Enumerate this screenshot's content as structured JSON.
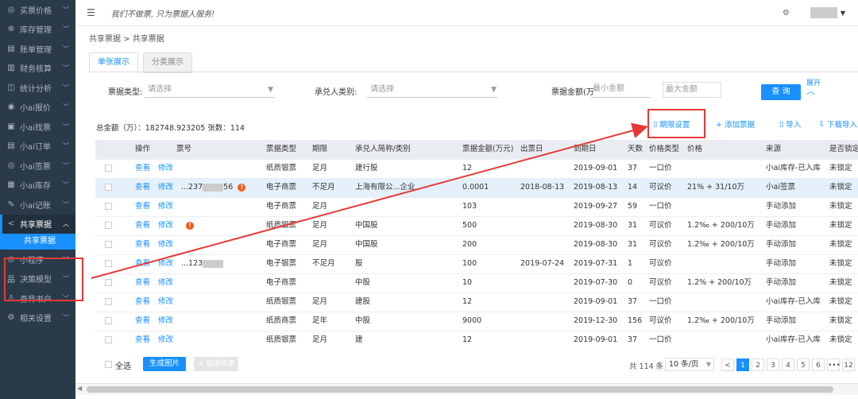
{
  "sidebar": {
    "items": [
      {
        "icon": "tag-icon",
        "glyph": "◎",
        "label": "买票价格"
      },
      {
        "icon": "box-icon",
        "glyph": "⊕",
        "label": "库存管理"
      },
      {
        "icon": "ledger-icon",
        "glyph": "▤",
        "label": "账单管理"
      },
      {
        "icon": "finance-icon",
        "glyph": "▥",
        "label": "财务核算"
      },
      {
        "icon": "chart-icon",
        "glyph": "◫",
        "label": "统计分析"
      },
      {
        "icon": "quote-icon",
        "glyph": "◉",
        "label": "小ai报价"
      },
      {
        "icon": "tickets-icon",
        "glyph": "▣",
        "label": "小ai找票"
      },
      {
        "icon": "order-icon",
        "glyph": "▤",
        "label": "小ai订单"
      },
      {
        "icon": "sign-icon",
        "glyph": "◎",
        "label": "小ai签票"
      },
      {
        "icon": "stock-icon",
        "glyph": "▦",
        "label": "小ai库存"
      },
      {
        "icon": "notes-icon",
        "glyph": "✎",
        "label": "小ai记账"
      },
      {
        "icon": "share-icon",
        "glyph": "<",
        "label": "共享票据"
      },
      {
        "icon": "miniapp-icon",
        "glyph": "◎",
        "label": "小程序"
      },
      {
        "icon": "model-icon",
        "glyph": "品",
        "label": "决策模型"
      },
      {
        "icon": "user-icon",
        "glyph": "♙",
        "label": "查背书户"
      },
      {
        "icon": "settings-icon",
        "glyph": "⚙",
        "label": "相关设置"
      }
    ],
    "sub_item": "共享票据"
  },
  "topbar": {
    "slogan": "我们不做票, 只为票据人服务!"
  },
  "breadcrumb": "共享票据 > 共享票据",
  "tabs": [
    "单张展示",
    "分类展示"
  ],
  "filters": {
    "type_label": "票据类型:",
    "type_placeholder": "请选择",
    "acceptor_label": "承兑人类别:",
    "acceptor_placeholder": "请选择",
    "amount_label": "票据金额(万",
    "min_placeholder": "最小金额",
    "max_placeholder": "最大金额",
    "query": "查 询",
    "expand": "展开"
  },
  "summary": {
    "text": "总金额（万）：182748.923205    张数：114"
  },
  "actions": {
    "term_setting": "期限设置",
    "add": "+ 添加票据",
    "import": "导入",
    "download": "下载导入"
  },
  "table": {
    "headers": [
      "操作",
      "票号",
      "票据类型",
      "期限",
      "承兑人简称/类别",
      "票据金额(万元)",
      "出票日",
      "到期日",
      "天数",
      "价格类型",
      "价格",
      "来源",
      "是否锁定"
    ],
    "view": "查看",
    "edit": "修改",
    "rows": [
      {
        "ticket": "",
        "warn": false,
        "type": "纸质银票",
        "term": "足月",
        "acceptor": "建行股",
        "amount": "12",
        "issue": "",
        "due": "2019-09-01",
        "days": "37",
        "price_type": "一口价",
        "price": "",
        "source": "小ai库存-已入库",
        "lock": "未锁定",
        "sel": false
      },
      {
        "ticket": "...237",
        "ticket_tail": "56",
        "warn": true,
        "type": "电子商票",
        "term": "不足月",
        "acceptor": "上海有限公...企业",
        "amount": "0.0001",
        "issue": "2018-08-13",
        "due": "2019-08-13",
        "days": "14",
        "price_type": "可议价",
        "price": "21% + 31/10万",
        "source": "小ai签票",
        "lock": "未锁定",
        "sel": true
      },
      {
        "ticket": "",
        "warn": false,
        "type": "电子商票",
        "term": "足月",
        "acceptor": "",
        "amount": "103",
        "issue": "",
        "due": "2019-09-27",
        "days": "59",
        "price_type": "一口价",
        "price": "",
        "source": "手动添加",
        "lock": "未锁定",
        "sel": false
      },
      {
        "ticket": "",
        "warn": true,
        "type": "纸质银票",
        "term": "足月",
        "acceptor": "中国股",
        "amount": "500",
        "issue": "",
        "due": "2019-08-30",
        "days": "31",
        "price_type": "可议价",
        "price": "1.2‰ + 200/10万",
        "source": "手动添加",
        "lock": "未锁定",
        "sel": false
      },
      {
        "ticket": "",
        "warn": false,
        "type": "电子商票",
        "term": "足月",
        "acceptor": "中国股",
        "amount": "200",
        "issue": "",
        "due": "2019-08-30",
        "days": "31",
        "price_type": "可议价",
        "price": "1.2‰ + 200/10万",
        "source": "手动添加",
        "lock": "未锁定",
        "sel": false
      },
      {
        "ticket": "...123",
        "warn": false,
        "type": "电子银票",
        "term": "不足月",
        "acceptor": "股",
        "amount": "100",
        "issue": "2019-07-24",
        "due": "2019-07-31",
        "days": "1",
        "price_type": "可议价",
        "price": "",
        "source": "手动添加",
        "lock": "未锁定",
        "sel": false
      },
      {
        "ticket": "",
        "warn": false,
        "type": "电子商票",
        "term": "",
        "acceptor": "中股",
        "amount": "10",
        "issue": "",
        "due": "2019-07-30",
        "days": "0",
        "price_type": "可议价",
        "price": "1.2% + 200/10万",
        "source": "手动添加",
        "lock": "未锁定",
        "sel": false
      },
      {
        "ticket": "",
        "warn": false,
        "type": "纸质银票",
        "term": "足月",
        "acceptor": "建股",
        "amount": "12",
        "issue": "",
        "due": "2019-09-01",
        "days": "37",
        "price_type": "一口价",
        "price": "",
        "source": "小ai库存-已入库",
        "lock": "未锁定",
        "sel": false
      },
      {
        "ticket": "",
        "warn": false,
        "type": "纸质商票",
        "term": "足年",
        "acceptor": "中股",
        "amount": "9000",
        "issue": "",
        "due": "2019-12-30",
        "days": "156",
        "price_type": "可议价",
        "price": "1.2‰ + 200/10万",
        "source": "手动添加",
        "lock": "未锁定",
        "sel": false
      },
      {
        "ticket": "",
        "warn": false,
        "type": "纸质银票",
        "term": "足月",
        "acceptor": "建",
        "amount": "12",
        "issue": "",
        "due": "2019-09-01",
        "days": "37",
        "price_type": "一口价",
        "price": "",
        "source": "小ai库存-已入库",
        "lock": "未锁定",
        "sel": false
      }
    ]
  },
  "footer": {
    "select_all": "全选",
    "gen_image": "生成图片",
    "cancel_share": "取消共享",
    "total": "共 114 条",
    "page_size": "10 条/页",
    "pages": [
      "1",
      "2",
      "3",
      "4",
      "5",
      "6",
      "•••",
      "12"
    ]
  }
}
